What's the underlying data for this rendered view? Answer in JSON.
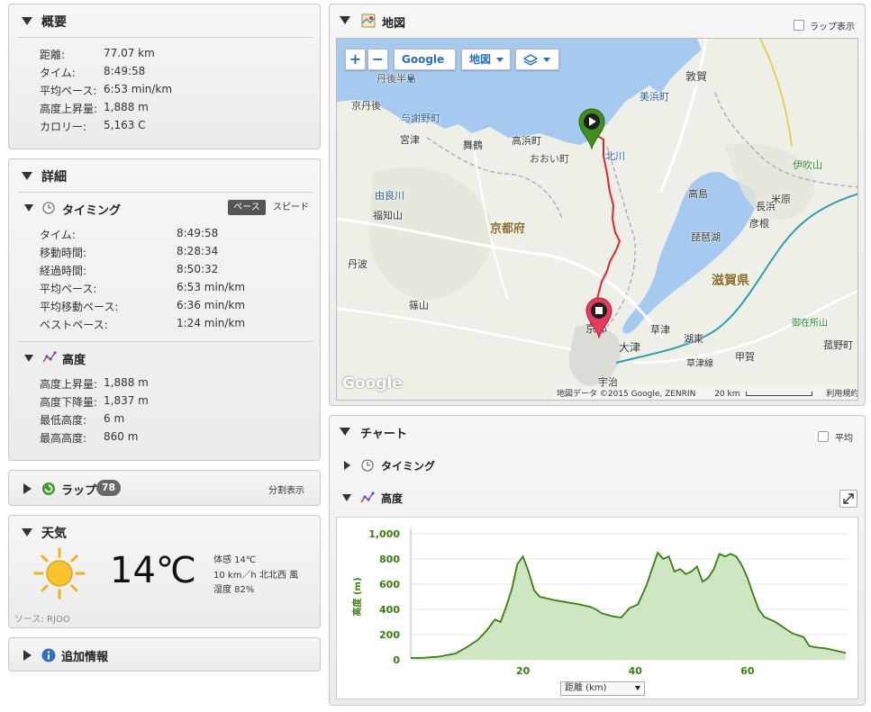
{
  "summary": {
    "title": "概要",
    "rows": [
      {
        "label": "距離:",
        "value": "77.07 km"
      },
      {
        "label": "タイム:",
        "value": "8:49:58"
      },
      {
        "label": "平均ペース:",
        "value": "6:53 min/km"
      },
      {
        "label": "高度上昇量:",
        "value": "1,888 m"
      },
      {
        "label": "カロリー:",
        "value": "5,163 C"
      }
    ]
  },
  "details": {
    "title": "詳細",
    "timing": {
      "title": "タイミング",
      "toggle_pace": "ペース",
      "toggle_speed": "スピード",
      "rows": [
        {
          "label": "タイム:",
          "value": "8:49:58"
        },
        {
          "label": "移動時間:",
          "value": "8:28:34"
        },
        {
          "label": "経過時間:",
          "value": "8:50:32"
        },
        {
          "label": "平均ペース:",
          "value": "6:53 min/km"
        },
        {
          "label": "平均移動ペース:",
          "value": "6:36 min/km"
        },
        {
          "label": "ベストペース:",
          "value": "1:24 min/km"
        }
      ]
    },
    "elevation": {
      "title": "高度",
      "rows": [
        {
          "label": "高度上昇量:",
          "value": "1,888 m"
        },
        {
          "label": "高度下降量:",
          "value": "1,837 m"
        },
        {
          "label": "最低高度:",
          "value": "6 m"
        },
        {
          "label": "最高高度:",
          "value": "860 m"
        }
      ]
    }
  },
  "laps": {
    "title": "ラップ",
    "count": "78",
    "split_label": "分割表示"
  },
  "weather": {
    "title": "天気",
    "temperature": "14℃",
    "feels_like": "体感 14℃",
    "wind": "10 km／h 北北西 風",
    "humidity": "湿度 82%",
    "source": "ソース: RJOO",
    "icon": "sun-icon"
  },
  "additional": {
    "title": "追加情報",
    "icon": "info-icon"
  },
  "map": {
    "title": "地図",
    "lap_display_label": "ラップ表示",
    "zoom_in": "+",
    "zoom_out": "−",
    "provider": "Google",
    "map_type": "地図",
    "layers_icon": "layers-icon",
    "attribution": "地図データ ©2015 Google, ZENRIN",
    "scale_label": "20 km",
    "terms": "利用規約",
    "logo": "Google",
    "labels": [
      "丹後半島",
      "敦賀",
      "京丹後",
      "与謝野町",
      "美浜町",
      "宮津",
      "舞鶴",
      "高浜町",
      "おおい町",
      "北川",
      "長浜",
      "伊吹山",
      "米原",
      "由良川",
      "福知山",
      "京都府",
      "高島",
      "彦根",
      "琵琶湖",
      "滋賀県",
      "丹波",
      "篠山",
      "京都",
      "草津",
      "湖東",
      "御在所山",
      "大津",
      "草津線",
      "甲賀",
      "菰野町",
      "宇治"
    ]
  },
  "chart": {
    "title": "チャート",
    "average_label": "平均",
    "timing_label": "タイミング",
    "elevation_label": "高度",
    "x_select": "距離 (km)",
    "expand_icon": "expand-icon"
  },
  "chart_data": {
    "type": "area",
    "title": "",
    "xlabel": "距離 (km)",
    "ylabel": "高度 (m)",
    "xlim": [
      0,
      78
    ],
    "ylim": [
      0,
      1000
    ],
    "x_ticks": [
      "20",
      "40",
      "60"
    ],
    "y_ticks": [
      "0",
      "200",
      "400",
      "600",
      "800",
      "1,000"
    ],
    "grid": true,
    "color": "#3a7d10",
    "fill": "#cfe6c2",
    "series": [
      {
        "name": "",
        "x": [
          0,
          2,
          5,
          8,
          10,
          12,
          13.5,
          15,
          16,
          17,
          18,
          19,
          20,
          21,
          22,
          23,
          24,
          26,
          28,
          30,
          32,
          33,
          34,
          36,
          37.5,
          39,
          40.5,
          42,
          43,
          44,
          45,
          46,
          47,
          48,
          49,
          50,
          51,
          52,
          53,
          54,
          55,
          56,
          57,
          58,
          59,
          60,
          61,
          62,
          63,
          64,
          65,
          66,
          68,
          70,
          71,
          72,
          74,
          76,
          77.5
        ],
        "y": [
          15,
          15,
          25,
          50,
          100,
          160,
          230,
          320,
          300,
          420,
          560,
          760,
          820,
          700,
          550,
          500,
          490,
          470,
          455,
          440,
          420,
          400,
          370,
          345,
          335,
          410,
          440,
          590,
          720,
          850,
          800,
          820,
          700,
          720,
          680,
          700,
          740,
          620,
          650,
          720,
          840,
          820,
          840,
          820,
          750,
          650,
          520,
          400,
          340,
          320,
          300,
          270,
          210,
          180,
          110,
          100,
          90,
          70,
          55
        ]
      }
    ]
  }
}
